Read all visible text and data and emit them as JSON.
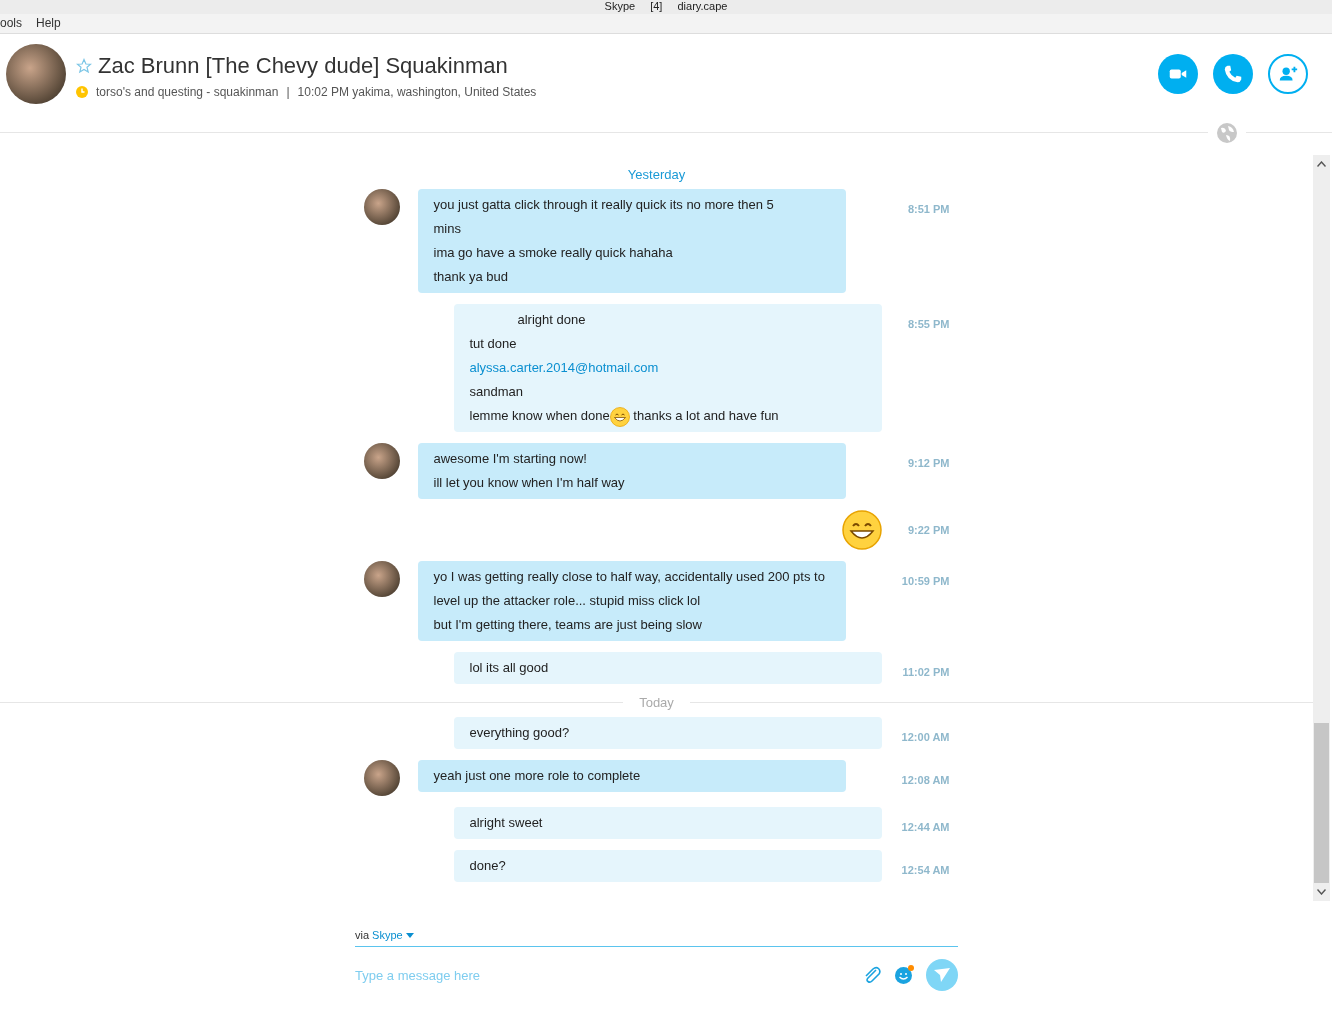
{
  "window": {
    "title": "Skype [4] diary.cape"
  },
  "menu": [
    "ools",
    "Help"
  ],
  "contact": {
    "name": "Zac Brunn [The Chevy dude] Squakinman",
    "favorite": false,
    "mood": "torso's and questing - squakinman",
    "separator": "|",
    "local_info": "10:02 PM yakima, washington, United States"
  },
  "call_buttons": [
    {
      "kind": "video"
    },
    {
      "kind": "call"
    },
    {
      "kind": "add"
    }
  ],
  "conversation": [
    {
      "kind": "divider",
      "label": "Yesterday",
      "line": false
    },
    {
      "kind": "message",
      "outgoing": false,
      "time": "8:51 PM",
      "lines": [
        {
          "text": "you just gatta click through it really quick its no more then 5"
        },
        {
          "text": "mins"
        },
        {
          "text": "ima go have a smoke really quick hahaha"
        },
        {
          "text": "thank ya bud"
        }
      ]
    },
    {
      "kind": "message",
      "outgoing": true,
      "time": "8:55 PM",
      "lines": [
        {
          "text": "alright done",
          "indent": true
        },
        {
          "text": "tut done"
        },
        {
          "text": "alyssa.carter.2014@hotmail.com",
          "link": true
        },
        {
          "text": "sandman"
        },
        {
          "text": "lemme know when done",
          "emoji": true,
          "rest": "thanks a lot and have fun"
        }
      ]
    },
    {
      "kind": "message",
      "outgoing": false,
      "time": "9:12 PM",
      "lines": [
        {
          "text": "awesome I'm starting now!"
        },
        {
          "text": "ill let you know when I'm half way"
        }
      ]
    },
    {
      "kind": "emoji",
      "time": "9:22 PM"
    },
    {
      "kind": "message",
      "outgoing": false,
      "time": "10:59 PM",
      "lines": [
        {
          "text": "yo I was getting really close to half way, accidentally used 200 pts to level up the attacker role... stupid miss click lol"
        },
        {
          "text": "but I'm getting there, teams are just being slow"
        }
      ]
    },
    {
      "kind": "message",
      "outgoing": true,
      "time": "11:02 PM",
      "lines": [
        {
          "text": "lol its all good"
        }
      ]
    },
    {
      "kind": "divider",
      "label": "Today",
      "line": true
    },
    {
      "kind": "message",
      "outgoing": true,
      "time": "12:00 AM",
      "lines": [
        {
          "text": "everything good?"
        }
      ]
    },
    {
      "kind": "message",
      "outgoing": false,
      "time": "12:08 AM",
      "lines": [
        {
          "text": "yeah just one more role to complete"
        }
      ]
    },
    {
      "kind": "message",
      "outgoing": true,
      "time": "12:44 AM",
      "lines": [
        {
          "text": "alright sweet"
        }
      ]
    },
    {
      "kind": "message",
      "outgoing": true,
      "time": "12:54 AM",
      "lines": [
        {
          "text": "done?"
        }
      ]
    }
  ],
  "composer": {
    "via": "via",
    "service": "Skype",
    "placeholder": "Type a message here",
    "emoticon_notification": true
  }
}
